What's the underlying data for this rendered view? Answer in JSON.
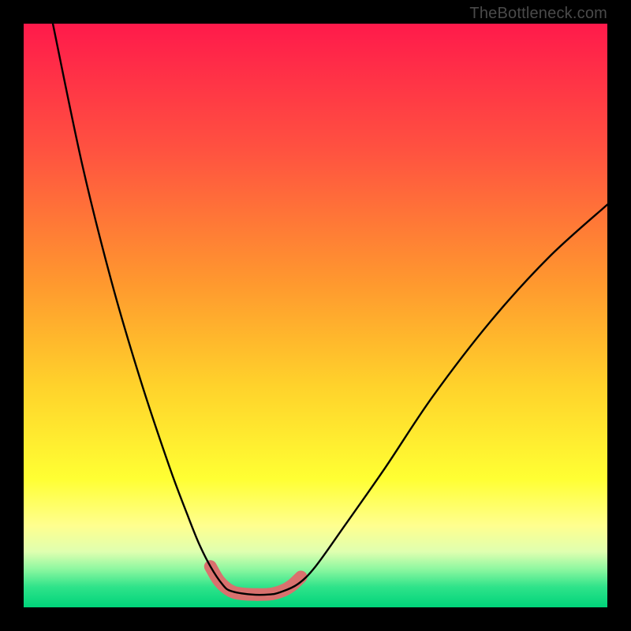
{
  "watermark": "TheBottleneck.com",
  "chart_data": {
    "type": "line",
    "title": "",
    "xlabel": "",
    "ylabel": "",
    "xlim": [
      0,
      100
    ],
    "ylim": [
      0,
      100
    ],
    "background_gradient_stops": [
      {
        "offset": 0.0,
        "color": "#ff1a4b"
      },
      {
        "offset": 0.22,
        "color": "#ff5340"
      },
      {
        "offset": 0.45,
        "color": "#ff9a2e"
      },
      {
        "offset": 0.62,
        "color": "#ffd22b"
      },
      {
        "offset": 0.78,
        "color": "#ffff33"
      },
      {
        "offset": 0.86,
        "color": "#ffff8f"
      },
      {
        "offset": 0.905,
        "color": "#dfffb0"
      },
      {
        "offset": 0.935,
        "color": "#8cf7a0"
      },
      {
        "offset": 0.965,
        "color": "#2fe38a"
      },
      {
        "offset": 1.0,
        "color": "#00d47a"
      }
    ],
    "series": [
      {
        "name": "bottleneck-curve",
        "stroke": "#000000",
        "stroke_width": 2.4,
        "x": [
          5,
          10,
          15,
          20,
          25,
          28,
          30,
          32,
          34,
          35.5,
          39,
          42,
          44,
          47,
          50,
          55,
          62,
          70,
          80,
          90,
          100
        ],
        "values": [
          100,
          76,
          56,
          39,
          24,
          16,
          11,
          7,
          4,
          2.8,
          2.2,
          2.2,
          2.6,
          4,
          7,
          14,
          24,
          36,
          49,
          60,
          69
        ]
      }
    ],
    "scatter_overlay": {
      "name": "highlight-points",
      "color": "#d9716e",
      "points": [
        {
          "x": 32.0,
          "y": 7.0,
          "r": 6
        },
        {
          "x": 33.5,
          "y": 4.5,
          "r": 6
        },
        {
          "x": 35.5,
          "y": 2.8,
          "r": 8
        },
        {
          "x": 37.5,
          "y": 2.3,
          "r": 8
        },
        {
          "x": 40.0,
          "y": 2.2,
          "r": 8
        },
        {
          "x": 42.5,
          "y": 2.3,
          "r": 8
        },
        {
          "x": 44.5,
          "y": 2.9,
          "r": 8
        },
        {
          "x": 46.0,
          "y": 3.8,
          "r": 6
        },
        {
          "x": 47.5,
          "y": 5.2,
          "r": 6
        }
      ]
    }
  }
}
